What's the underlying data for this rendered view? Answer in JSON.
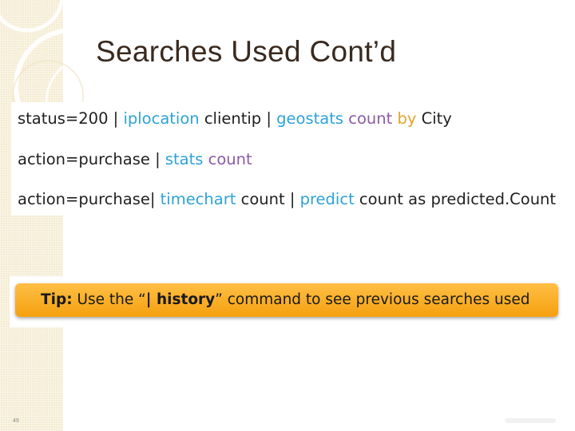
{
  "slide": {
    "title": "Searches Used Cont’d",
    "page_number": "49"
  },
  "commands": {
    "line1": {
      "part1": "status=200",
      "pipe1": " | ",
      "cmd1": "iplocation",
      "arg1": " clientip",
      "pipe2": " | ",
      "cmd2": "geostats",
      "agg": " count",
      "by": " by",
      "field": " City"
    },
    "line2": {
      "part1": "action=purchase",
      "pipe1": " | ",
      "cmd1": "stats",
      "agg": " count"
    },
    "line3": {
      "part1": "action=purchase|",
      "cmd1": " timechart",
      "arg1": " count",
      "pipe1": " | ",
      "cmd2": "predict",
      "arg2": " count as predicted.Count"
    }
  },
  "tip": {
    "label": "Tip:",
    "text_before": " Use the “",
    "command": "| history",
    "text_after": "” command to see previous searches used"
  },
  "colors": {
    "command_blue": "#2ea2d8",
    "function_purple": "#8b5aa8",
    "keyword_gold": "#e0a52a",
    "tip_orange": "#f5a00f",
    "side_band": "#f5ecd3"
  }
}
